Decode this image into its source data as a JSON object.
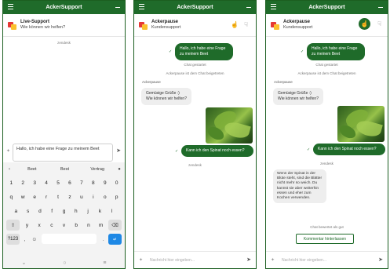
{
  "app": {
    "title": "AckerSupport"
  },
  "screen1": {
    "header": {
      "name": "Live-Support",
      "subtitle": "Wie können wir helfen?"
    },
    "brand": "zendesk",
    "composer_text": "Hallo, ich habe eine Frage zu meinem Beet",
    "suggestions": [
      "Beet",
      "Best",
      "Vertrag"
    ],
    "keys_row1": [
      "1",
      "2",
      "3",
      "4",
      "5",
      "6",
      "7",
      "8",
      "9",
      "0"
    ],
    "keys_row2": [
      "q",
      "w",
      "e",
      "r",
      "t",
      "z",
      "u",
      "i",
      "o",
      "p"
    ],
    "keys_row3": [
      "a",
      "s",
      "d",
      "f",
      "g",
      "h",
      "j",
      "k",
      "l"
    ],
    "keys_row4": [
      "y",
      "x",
      "c",
      "v",
      "b",
      "n",
      "m"
    ],
    "key_symbols": "?123",
    "key_comma": ",",
    "key_period": "."
  },
  "screen2": {
    "header": {
      "name": "Ackerpause",
      "subtitle": "Kundensupport"
    },
    "user_message": "Hallo, ich habe eine Frage zu meinem Beet",
    "chat_started": "Chat gestartet",
    "agent_joined": "Ackerpause ist dem Chat beigetreten",
    "agent_label": "Ackerpause",
    "agent_message": "Gemüsige Grüße :) Wie können wir helfen?",
    "question": "Kann ich den Spinat noch essen?",
    "brand": "zendesk",
    "placeholder": "Nachricht hier eingeben..."
  },
  "screen3": {
    "header": {
      "name": "Ackerpause",
      "subtitle": "Kundensupport"
    },
    "user_message": "Hallo, ich habe eine Frage zu meinem Beet",
    "chat_started": "Chat gestartet",
    "agent_joined": "Ackerpause ist dem Chat beigetreten",
    "agent_label": "Ackerpause",
    "agent_message": "Gemüsige Grüße :) Wie können wir helfen?",
    "question": "Kann ich den Spinat noch essen?",
    "brand": "zendesk",
    "answer": "Wenn der Spinat in der Blüte steht, sind die Blätter nicht mehr so weich. Du kannst sie aber weiterhin essen und eher zum Kochen verwenden.",
    "rating": "Chat bewertet als gut",
    "feedback_button": "Kommentar hinterlassen",
    "placeholder": "Nachricht hier eingeben..."
  },
  "icons": {
    "menu": "hamburger-icon",
    "thumbs_up": "thumbs-up-icon",
    "thumbs_down": "thumbs-down-icon",
    "send": "send-icon",
    "attach": "paperclip-icon"
  },
  "colors": {
    "primary": "#1f6b2a",
    "enter_key": "#1e88e5"
  }
}
